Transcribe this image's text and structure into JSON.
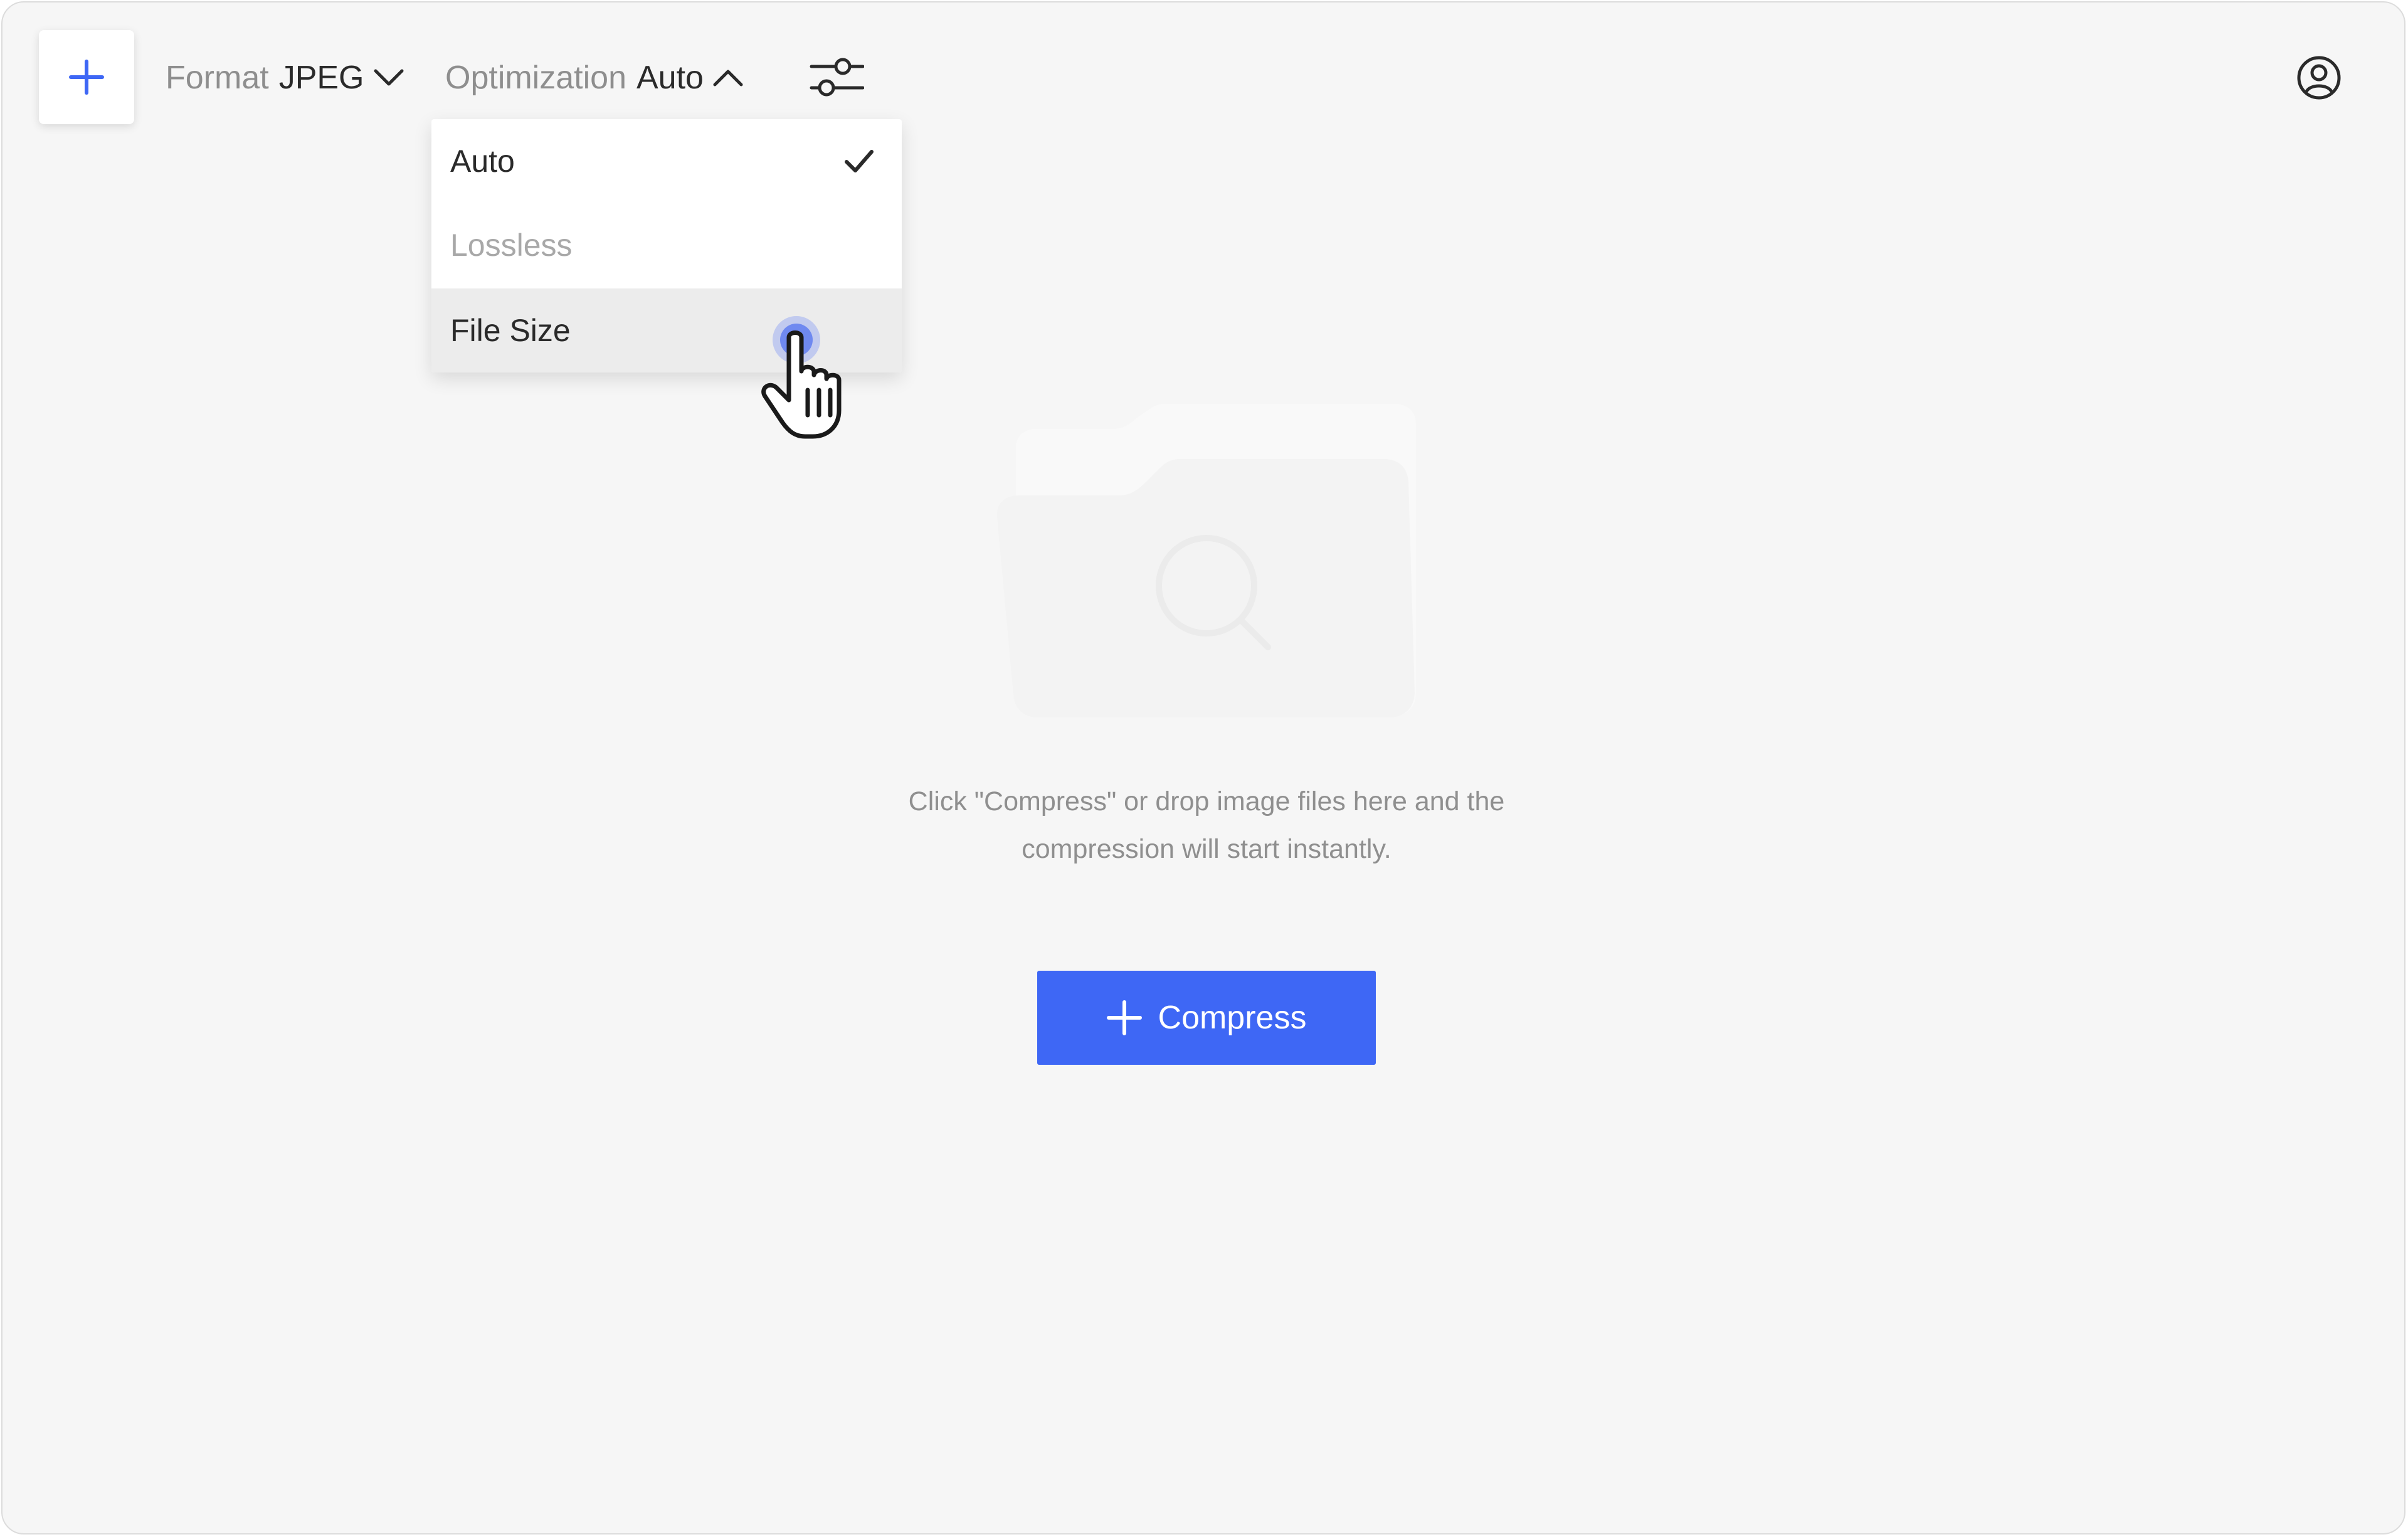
{
  "toolbar": {
    "add_icon": "plus-icon",
    "format": {
      "label": "Format",
      "value": "JPEG",
      "icon": "chevron-down-icon"
    },
    "optimization": {
      "label": "Optimization",
      "value": "Auto",
      "icon": "chevron-up-icon"
    },
    "settings_icon": "sliders-icon",
    "user_icon": "user-circle-icon"
  },
  "dropdown": {
    "items": [
      {
        "label": "Auto",
        "state": "selected"
      },
      {
        "label": "Lossless",
        "state": "disabled"
      },
      {
        "label": "File Size",
        "state": "hovered"
      }
    ]
  },
  "empty_state": {
    "icon": "folder-search-icon",
    "hint_line1": "Click \"Compress\" or drop image files here and the",
    "hint_line2": "compression will start instantly."
  },
  "compress_button": {
    "label": "Compress",
    "icon": "plus-icon"
  },
  "colors": {
    "accent": "#3e67f5",
    "background": "#f6f6f6",
    "text": "#2a2a2a",
    "muted": "#8e8e8e"
  }
}
